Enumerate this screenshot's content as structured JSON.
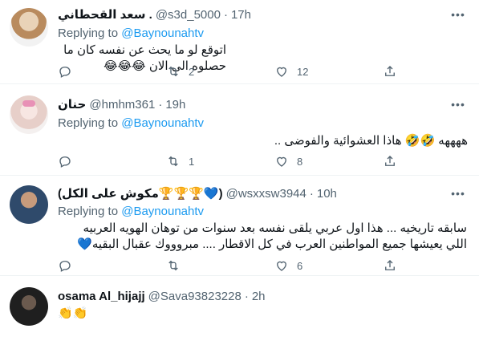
{
  "tweets": [
    {
      "name": "سعد القحطاني .",
      "handle": "@s3d_5000",
      "time": "17h",
      "replying_prefix": "Replying to",
      "replying_to": "@Baynounahtv",
      "text": "اتوقع لو ما يحث عن نفسه كان ما حصلوه الى الان 😂😂😂",
      "reply_count": "",
      "retweet_count": "2",
      "like_count": "12",
      "avatar_color": "#c8a27a"
    },
    {
      "name": "حنان",
      "handle": "@hmhm361",
      "time": "19h",
      "replying_prefix": "Replying to",
      "replying_to": "@Baynounahtv",
      "text": "ههههه 🤣🤣 هاذا العشوائية والفوضى ..",
      "reply_count": "",
      "retweet_count": "1",
      "like_count": "8",
      "avatar_color": "#e8d5d2"
    },
    {
      "name": "(مكوش على الكل🏆🏆🏆💙)",
      "handle": "@wsxxsw3944",
      "time": "10h",
      "replying_prefix": "Replying to",
      "replying_to": "@Baynounahtv",
      "text_line1": "سابقه تاريخيه ... هذا اول عربي يلقى نفسه بعد سنوات من توهان الهويه العربيه",
      "text_line2": "اللي يعيشها جميع المواطنين العرب في كل الاقطار .... مبروووك عقبال البقيه💙",
      "reply_count": "",
      "retweet_count": "",
      "like_count": "6",
      "avatar_color": "#2f4a6b"
    },
    {
      "name": "osama Al_hijajj",
      "handle": "@Sava93823228",
      "time": "2h",
      "text": "👏👏",
      "avatar_color": "#2a2a2a"
    }
  ],
  "separator": "·",
  "more_icon": "more-horizontal-icon",
  "accent_color": "#1d9bf0",
  "muted_color": "#536471"
}
